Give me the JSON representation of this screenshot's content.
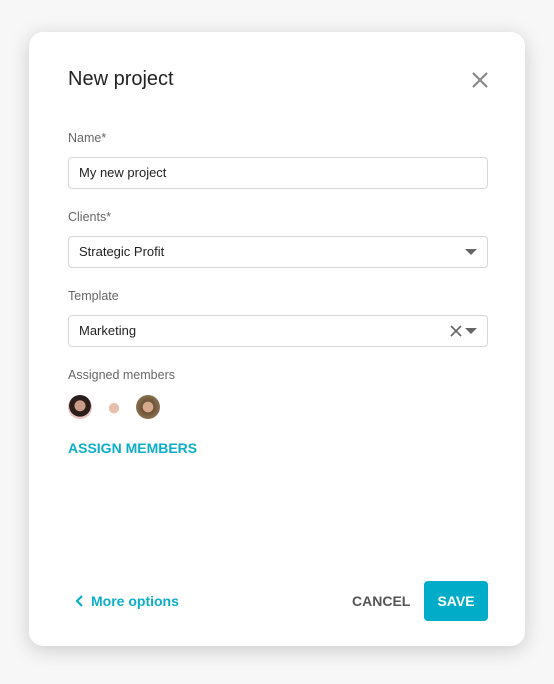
{
  "dialog": {
    "title": "New project"
  },
  "name": {
    "label": "Name*",
    "value": "My new project"
  },
  "clients": {
    "label": "Clients*",
    "value": "Strategic Profit"
  },
  "template": {
    "label": "Template",
    "value": "Marketing"
  },
  "members": {
    "label": "Assigned members",
    "assign_label": "ASSIGN MEMBERS"
  },
  "footer": {
    "more_options": "More options",
    "cancel": "CANCEL",
    "save": "SAVE"
  },
  "colors": {
    "accent": "#00acc8"
  }
}
